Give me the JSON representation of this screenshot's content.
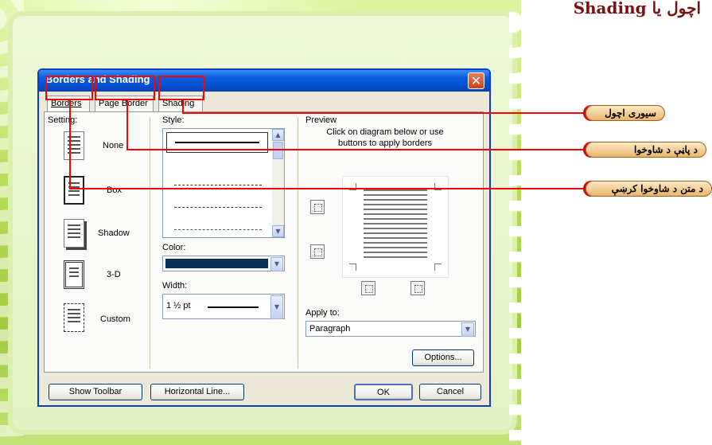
{
  "slide": {
    "title": "اچول يا Shading"
  },
  "dialog": {
    "title": "Borders and Shading",
    "close_glyph": "✕",
    "tabs": [
      {
        "label": "Borders"
      },
      {
        "label": "Page Border"
      },
      {
        "label": "Shading"
      }
    ],
    "setting": {
      "label": "Setting:",
      "options": [
        {
          "label": "None"
        },
        {
          "label": "Box"
        },
        {
          "label": "Shadow"
        },
        {
          "label": "3-D"
        },
        {
          "label": "Custom"
        }
      ]
    },
    "style": {
      "label": "Style:"
    },
    "color": {
      "label": "Color:",
      "value_hex": "#0a2d57"
    },
    "width": {
      "label": "Width:",
      "value": "1 ½ pt"
    },
    "preview": {
      "label": "Preview",
      "instruction": "Click on diagram below or use buttons to apply borders"
    },
    "apply_to": {
      "label": "Apply to:",
      "value": "Paragraph"
    },
    "buttons": {
      "options": "Options...",
      "show_toolbar": "Show Toolbar",
      "horizontal_line": "Horizontal Line...",
      "ok": "OK",
      "cancel": "Cancel"
    }
  },
  "callouts": [
    {
      "label": "سيورى اچول"
    },
    {
      "label": "د پاڼې د شاوخوا"
    },
    {
      "label": "د متن د شاوخوا كرښې"
    }
  ],
  "colors": {
    "highlight": "#ff0000",
    "titlebar": "#0a5ee0",
    "slide_title": "#7a1010"
  }
}
